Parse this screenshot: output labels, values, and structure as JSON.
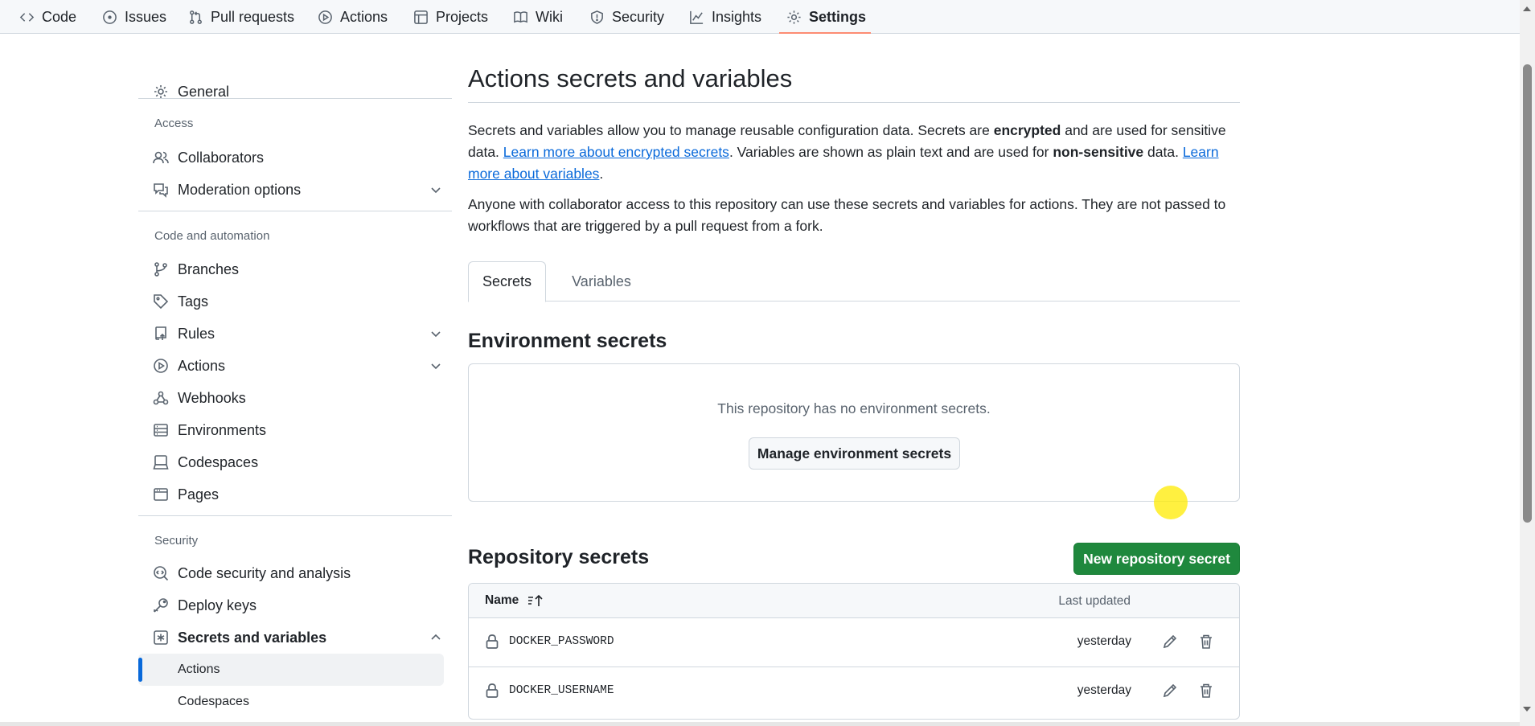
{
  "topnav": {
    "tabs": [
      {
        "label": "Code",
        "icon": "code-icon"
      },
      {
        "label": "Issues",
        "icon": "issue-icon"
      },
      {
        "label": "Pull requests",
        "icon": "pull-request-icon"
      },
      {
        "label": "Actions",
        "icon": "play-icon"
      },
      {
        "label": "Projects",
        "icon": "table-icon"
      },
      {
        "label": "Wiki",
        "icon": "book-icon"
      },
      {
        "label": "Security",
        "icon": "shield-icon"
      },
      {
        "label": "Insights",
        "icon": "graph-icon"
      },
      {
        "label": "Settings",
        "icon": "gear-icon"
      }
    ],
    "active": "Settings"
  },
  "sidebar": {
    "general": "General",
    "access_heading": "Access",
    "collaborators": "Collaborators",
    "moderation": "Moderation options",
    "code_heading": "Code and automation",
    "branches": "Branches",
    "tags": "Tags",
    "rules": "Rules",
    "actions": "Actions",
    "webhooks": "Webhooks",
    "environments": "Environments",
    "codespaces": "Codespaces",
    "pages": "Pages",
    "security_heading": "Security",
    "code_security": "Code security and analysis",
    "deploy_keys": "Deploy keys",
    "secrets_vars": "Secrets and variables",
    "sub_actions": "Actions",
    "sub_codespaces": "Codespaces"
  },
  "main": {
    "title": "Actions secrets and variables",
    "intro": {
      "p1_a": "Secrets and variables allow you to manage reusable configuration data. Secrets are ",
      "p1_b": "encrypted",
      "p1_c": " and are used for sensitive data. ",
      "p1_link1": "Learn more about encrypted secrets",
      "p1_d": ". Variables are shown as plain text and are used for ",
      "p1_e": "non-sensitive",
      "p1_f": " data. ",
      "p1_link2": "Learn more about variables",
      "p1_g": ".",
      "p2": "Anyone with collaborator access to this repository can use these secrets and variables for actions. They are not passed to workflows that are triggered by a pull request from a fork."
    },
    "tabs": {
      "secrets": "Secrets",
      "variables": "Variables"
    },
    "env_heading": "Environment secrets",
    "env_empty": "This repository has no environment secrets.",
    "env_button": "Manage environment secrets",
    "repo_heading": "Repository secrets",
    "new_secret_button": "New repository secret",
    "table": {
      "col_name": "Name",
      "col_updated": "Last updated",
      "rows": [
        {
          "name": "DOCKER_PASSWORD",
          "updated": "yesterday"
        },
        {
          "name": "DOCKER_USERNAME",
          "updated": "yesterday"
        }
      ]
    }
  },
  "colors": {
    "accent": "#0969da",
    "primary_button": "#1f883d",
    "active_underline": "#fd8c73"
  }
}
